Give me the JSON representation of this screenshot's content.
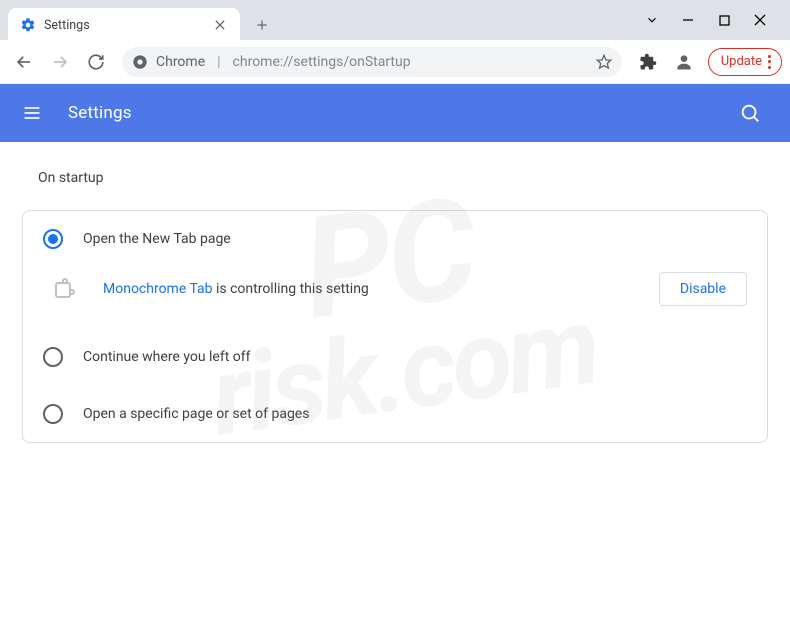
{
  "window": {
    "tab_title": "Settings"
  },
  "toolbar": {
    "omnibox_prefix": "Chrome",
    "omnibox_url": "chrome://settings/onStartup",
    "update_label": "Update"
  },
  "header": {
    "title": "Settings"
  },
  "content": {
    "section_title": "On startup",
    "options": [
      {
        "label": "Open the New Tab page",
        "selected": true
      },
      {
        "label": "Continue where you left off",
        "selected": false
      },
      {
        "label": "Open a specific page or set of pages",
        "selected": false
      }
    ],
    "extension_notice": {
      "extension_name": "Monochrome Tab",
      "rest": " is controlling this setting"
    },
    "disable_label": "Disable"
  },
  "watermark": {
    "line1": "PC",
    "line2": "risk.com"
  }
}
